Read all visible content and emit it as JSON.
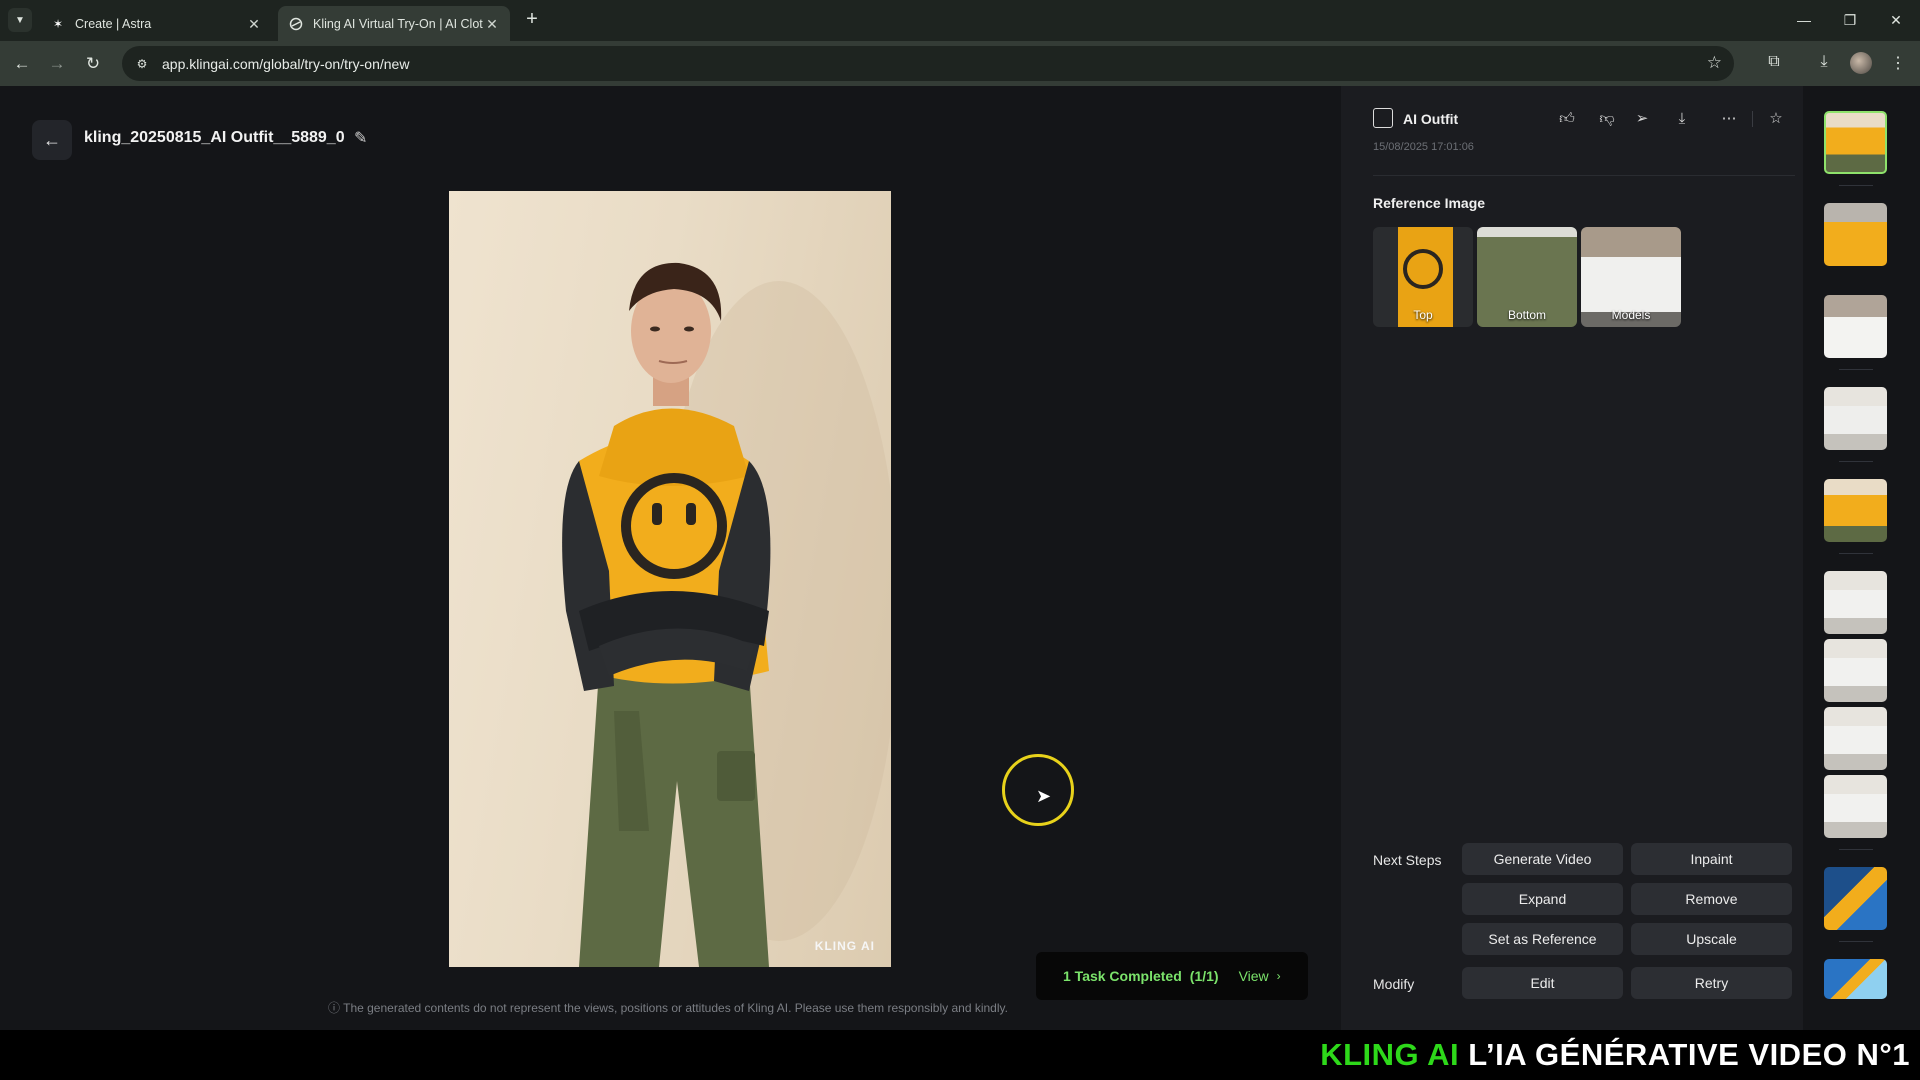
{
  "browser": {
    "tabs": [
      {
        "title": "Create | Astra",
        "active": false
      },
      {
        "title": "Kling AI Virtual Try-On | AI Clot",
        "active": true
      }
    ],
    "url": "app.klingai.com/global/try-on/try-on/new"
  },
  "page": {
    "file_title": "kling_20250815_AI Outfit__5889_0",
    "watermark": "KLING AI",
    "task_status": "1 Task Completed",
    "task_count": "(1/1)",
    "task_view": "View",
    "disclaimer": "The generated contents do not represent the views, positions or attitudes of Kling AI. Please use them responsibly and kindly."
  },
  "panel": {
    "title": "AI Outfit",
    "date": "15/08/2025 17:01:06",
    "reference_title": "Reference Image",
    "references": [
      {
        "label": "Top"
      },
      {
        "label": "Bottom"
      },
      {
        "label": "Models"
      }
    ],
    "next_steps_label": "Next Steps",
    "modify_label": "Modify",
    "actions": {
      "generate_video": "Generate Video",
      "inpaint": "Inpaint",
      "expand": "Expand",
      "remove": "Remove",
      "set_as_reference": "Set as Reference",
      "upscale": "Upscale",
      "edit": "Edit",
      "retry": "Retry"
    }
  },
  "banner": {
    "brand": "KLING AI",
    "tagline": "L’IA GÉNÉRATIVE VIDEO N°1"
  },
  "colors": {
    "accent_green": "#7be36b",
    "banner_green": "#2ed91a",
    "cursor_ring": "#e8d21b",
    "hoodie_yellow": "#f2ad1c",
    "pants_olive": "#5d6a44"
  }
}
